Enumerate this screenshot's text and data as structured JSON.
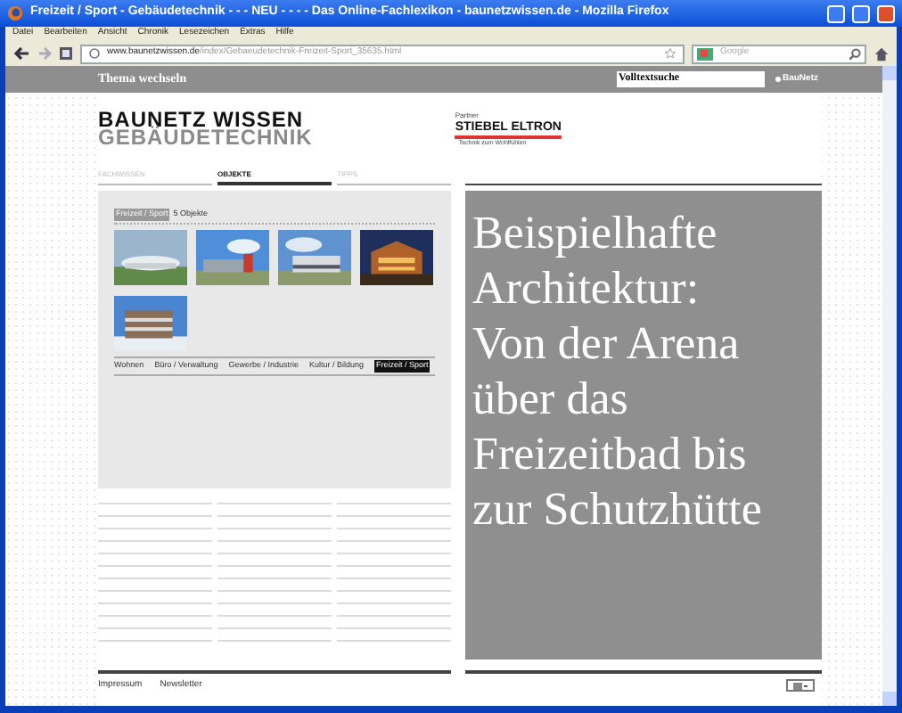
{
  "window": {
    "title": "Freizeit / Sport - Gebäudetechnik - - - NEU - - - - Das Online-Fachlexikon - baunetzwissen.de - Mozilla Firefox"
  },
  "menu": [
    "Datei",
    "Bearbeiten",
    "Ansicht",
    "Chronik",
    "Lesezeichen",
    "Extras",
    "Hilfe"
  ],
  "address_bar": {
    "domain": "www.baunetzwissen.de",
    "path": "/index/Gebaeudetechnik-Freizeit-Sport_35635.html"
  },
  "search": {
    "placeholder": "Google"
  },
  "site_header": {
    "topic_link": "Thema wechseln",
    "search_field": "Volltextsuche",
    "brand": "BauNetz"
  },
  "logo": {
    "line1": "BAUNETZ WISSEN",
    "line2": "GEBÄUDETECHNIK"
  },
  "partner": {
    "label": "Partner",
    "name": "STIEBEL ELTRON",
    "slogan": "Technik zum Wohlfühlen"
  },
  "tabs": [
    {
      "label": "FACHWISSEN",
      "selected": false
    },
    {
      "label": "OBJEKTE",
      "selected": true
    },
    {
      "label": "TIPPS",
      "selected": false
    }
  ],
  "objects": {
    "category": "Freizeit / Sport",
    "count": "5 Objekte",
    "filters": [
      {
        "label": "Wohnen",
        "selected": false
      },
      {
        "label": "Büro / Verwaltung",
        "selected": false
      },
      {
        "label": "Gewerbe / Industrie",
        "selected": false
      },
      {
        "label": "Kultur / Bildung",
        "selected": false
      },
      {
        "label": "Freizeit / Sport",
        "selected": true
      }
    ]
  },
  "feature": {
    "text": "Beispielhafte Architektur: Von der Arena über das Freizeitbad bis zur Schutzhütte"
  },
  "footer": {
    "links": [
      "Impressum",
      "Newsletter"
    ]
  }
}
